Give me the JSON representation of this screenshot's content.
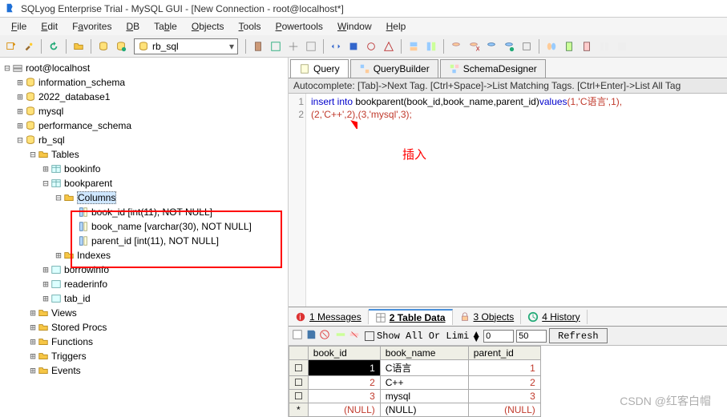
{
  "title": "SQLyog Enterprise Trial - MySQL GUI - [New Connection - root@localhost*]",
  "menu": [
    "File",
    "Edit",
    "Favorites",
    "DB",
    "Table",
    "Objects",
    "Tools",
    "Powertools",
    "Window",
    "Help"
  ],
  "combo_db": "rb_sql",
  "tabs": {
    "query": "Query",
    "qb": "QueryBuilder",
    "sd": "SchemaDesigner"
  },
  "hint": "Autocomplete: [Tab]->Next Tag. [Ctrl+Space]->List Matching Tags. [Ctrl+Enter]->List All Tag",
  "sql_l1_a": "insert into ",
  "sql_l1_b": "bookparent(book_id,book_name,parent_id)",
  "sql_l1_c": "values",
  "sql_l1_d": "(1,'C语言',1),",
  "sql_l2": "(2,'C++',2),(3,'mysql',3);",
  "annot": "插入",
  "tree": {
    "root": "root@localhost",
    "d1": "information_schema",
    "d2": "2022_database1",
    "d3": "mysql",
    "d4": "performance_schema",
    "d5": "rb_sql",
    "tables": "Tables",
    "t1": "bookinfo",
    "t2": "bookparent",
    "cols": "Columns",
    "c1": "book_id [int(11), NOT NULL]",
    "c2": "book_name [varchar(30), NOT NULL]",
    "c3": "parent_id [int(11), NOT NULL]",
    "idx": "Indexes",
    "t3": "borrowinfo",
    "t4": "readerinfo",
    "t5": "tab_id",
    "views": "Views",
    "sp": "Stored Procs",
    "fn": "Functions",
    "tr": "Triggers",
    "ev": "Events"
  },
  "btabs": {
    "m": "1 Messages",
    "td": "2 Table Data",
    "o": "3 Objects",
    "h": "4 History"
  },
  "btool": {
    "showall": "Show All Or  Limi",
    "v1": "0",
    "v2": "50",
    "refresh": "Refresh"
  },
  "grid": {
    "h1": "book_id",
    "h2": "book_name",
    "h3": "parent_id",
    "rows": [
      {
        "id": "1",
        "name": "C语言",
        "pid": "1"
      },
      {
        "id": "2",
        "name": "C++",
        "pid": "2"
      },
      {
        "id": "3",
        "name": "mysql",
        "pid": "3"
      }
    ],
    "null": "(NULL)"
  },
  "watermark": "CSDN @红客白帽"
}
